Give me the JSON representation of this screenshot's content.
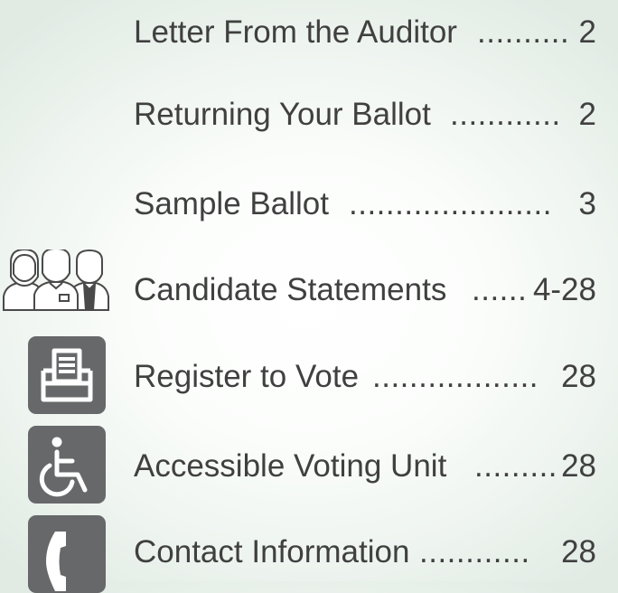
{
  "toc": {
    "entries": [
      {
        "label": "Letter From the Auditor",
        "dots": "..........",
        "page": "2"
      },
      {
        "label": "Returning Your Ballot",
        "dots": "............",
        "page": "2"
      },
      {
        "label": "Sample Ballot",
        "dots": "......................",
        "page": "3"
      },
      {
        "label": "Candidate Statements",
        "dots": "......",
        "page": "4-28"
      },
      {
        "label": "Register to Vote",
        "dots": "..................",
        "page": "28"
      },
      {
        "label": "Accessible Voting Unit",
        "dots": ".........",
        "page": "28"
      },
      {
        "label": "Contact Information",
        "dots": "............",
        "page": "28"
      }
    ]
  },
  "icons": {
    "candidates": "people-group-icon",
    "register": "ballot-box-icon",
    "accessible": "wheelchair-icon",
    "contact": "telephone-icon"
  },
  "colors": {
    "text": "#404040",
    "icon_tile": "#67686a",
    "background_center": "#ffffff",
    "background_edge": "#e1ebe4"
  }
}
